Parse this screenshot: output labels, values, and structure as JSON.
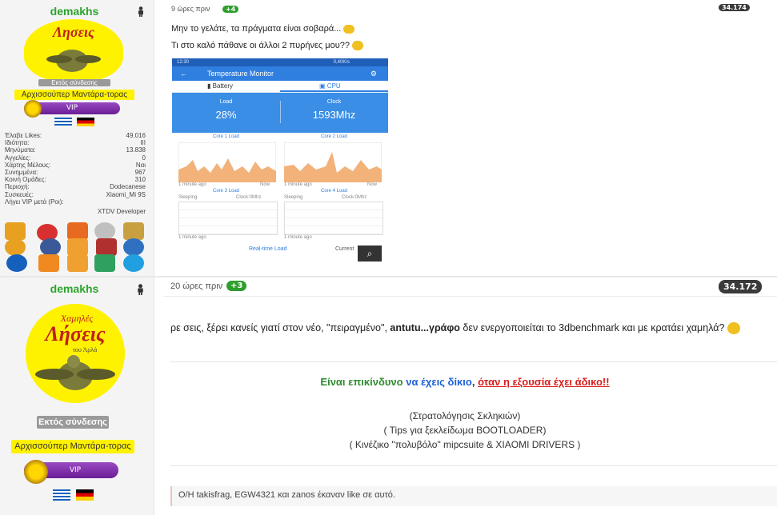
{
  "post_top": {
    "username": "demakhs",
    "status": "Εκτός σύνδεσης",
    "rank": "Αρχισσούπερ Μαντάρα-τορας",
    "vip": "VIP",
    "stats": [
      {
        "label": "Έλαβε Likes:",
        "value": "49.016"
      },
      {
        "label": "Ιδιότητα:",
        "value": "ΙΙΙ"
      },
      {
        "label": "Μηνύματα:",
        "value": "13.838"
      },
      {
        "label": "Αγγελίες:",
        "value": "0"
      },
      {
        "label": "Χάρτης Μέλους:",
        "value": "Ναι"
      },
      {
        "label": "Συνημμένα:",
        "value": "967"
      },
      {
        "label": "Κοινή Ομάδες:",
        "value": "310"
      },
      {
        "label": "Περιοχή:",
        "value": "Dodecanese"
      },
      {
        "label": "Συσκευές:",
        "value": "Xiaomi_Mi 9S"
      },
      {
        "label": "Λήγει VIP μετά (Ροι):",
        "value": ""
      }
    ],
    "role": "XTDV Developer",
    "time": "9 ώρες πριν",
    "likes": "+4",
    "count": "34.174",
    "line1": "Μην το γελάτε, τα πράγματα είναι σοβαρά...",
    "line2": "Τι στο καλό πάθανε οι άλλοι 2 πυρήνες μου??",
    "app": {
      "title": "Temperature Monitor",
      "statusbar_left": "12:30",
      "statusbar_right": "0,40K/s",
      "tab_battery": "Battery",
      "tab_cpu": "CPU",
      "load_label": "Load",
      "load_value": "28%",
      "clock_label": "Clock",
      "clock_value": "1593Mhz",
      "core1": "Core 1 Load",
      "core2": "Core 2 Load",
      "core3": "Core 3 Load",
      "core4": "Core 4 Load",
      "sleeping": "Sleeping",
      "clock_small": "Clock:0Mhz",
      "minute_ago": "1 minute ago",
      "now": "Now",
      "realtime": "Real-time Load",
      "current": "Current"
    }
  },
  "post_bottom": {
    "username": "demakhs",
    "status": "Εκτός σύνδεσης",
    "rank": "Αρχισσούπερ Μαντάρα-τορας",
    "vip": "VIP",
    "time": "20 ώρες πριν",
    "likes": "+3",
    "count": "34.172",
    "body_a": "ρε σεις, ξέρει κανείς γιατί στον νέο, \"πειραγμένο\", ",
    "body_b": "antutu...γράφο",
    "body_c": " δεν ενεργοποιείται το 3dbenchmark και με κρατάει χαμηλά?",
    "quote_a": "Είναι επικίνδυνο ",
    "quote_b": "να έχεις δίκιο",
    "quote_c": ", ",
    "quote_d": "όταν η εξουσία έχει άδικο!!",
    "sig1": "(Στρατολόγησις Σκληκιών)",
    "sig2": "( Tips για ξεκλείδωμα BOOTLOADER)",
    "sig3": "( Κινέζικο \"πολυβόλο\" mipcsuite & XIAOMI DRIVERS )",
    "likes_line": "O/H takisfrag, EGW4321 και zanos έκαναν like σε αυτό."
  },
  "colors": {
    "username": "#2ca52c",
    "plus_badge": "#2e9e2e",
    "rank_bg": "#fff200",
    "vip": "#7a2aa8",
    "app_blue": "#2f7fe0"
  },
  "icons": [
    "person-icon",
    "smiley-icon",
    "back-arrow-icon",
    "settings-icon",
    "battery-icon",
    "cpu-icon",
    "search-icon"
  ]
}
